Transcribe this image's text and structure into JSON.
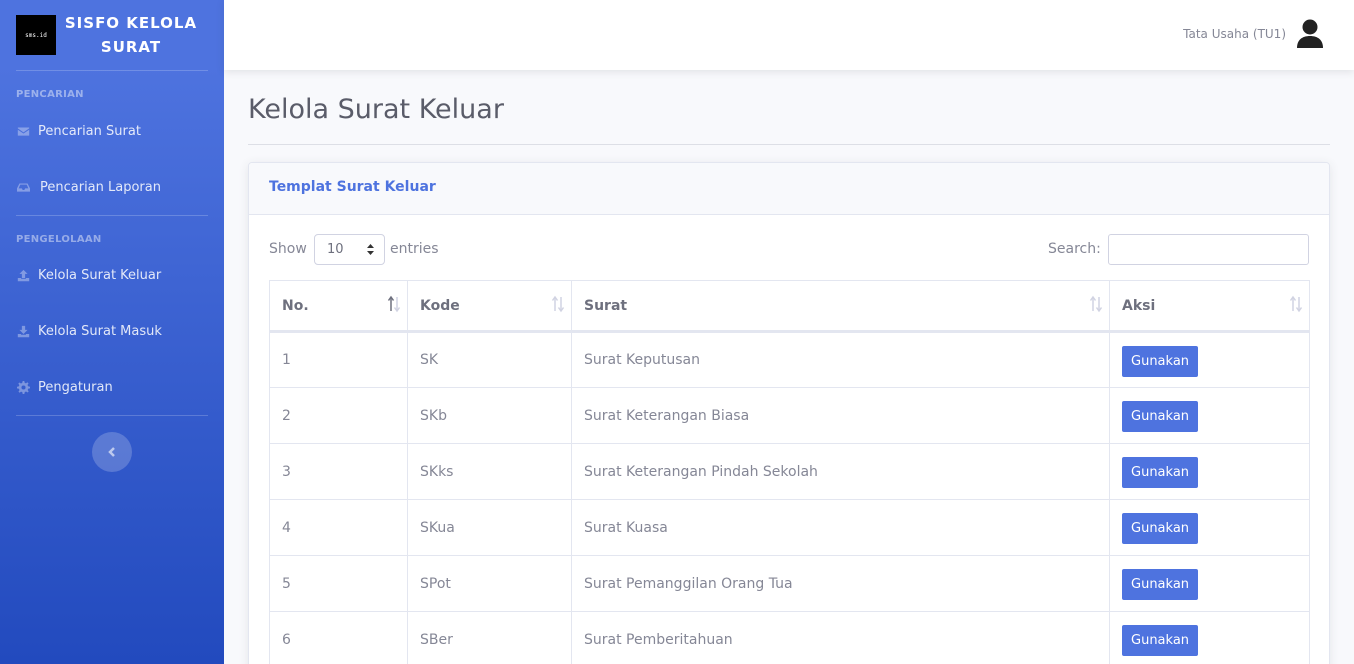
{
  "brand": {
    "title": "SISFO KELOLA SURAT",
    "logo_text": "sms.id"
  },
  "sidebar": {
    "heading_search": "PENCARIAN",
    "heading_manage": "PENGELOLAAN",
    "items": [
      {
        "label": "Pencarian Surat",
        "icon": "envelope-icon"
      },
      {
        "label": "Pencarian Laporan",
        "icon": "inbox-icon"
      },
      {
        "label": "Kelola Surat Keluar",
        "icon": "upload-icon"
      },
      {
        "label": "Kelola Surat Masuk",
        "icon": "download-icon"
      },
      {
        "label": "Pengaturan",
        "icon": "gear-icon"
      }
    ]
  },
  "topbar": {
    "user_name": "Tata Usaha (TU1)"
  },
  "page": {
    "title": "Kelola Surat Keluar"
  },
  "card": {
    "title": "Templat Surat Keluar"
  },
  "table_controls": {
    "show_label": "Show",
    "entries_label": "entries",
    "page_length": "10",
    "search_label": "Search:",
    "search_value": ""
  },
  "table": {
    "columns": [
      "No.",
      "Kode",
      "Surat",
      "Aksi"
    ],
    "action_label": "Gunakan",
    "rows": [
      {
        "no": "1",
        "kode": "SK",
        "surat": "Surat Keputusan"
      },
      {
        "no": "2",
        "kode": "SKb",
        "surat": "Surat Keterangan Biasa"
      },
      {
        "no": "3",
        "kode": "SKks",
        "surat": "Surat Keterangan Pindah Sekolah"
      },
      {
        "no": "4",
        "kode": "SKua",
        "surat": "Surat Kuasa"
      },
      {
        "no": "5",
        "kode": "SPot",
        "surat": "Surat Pemanggilan Orang Tua"
      },
      {
        "no": "6",
        "kode": "SBer",
        "surat": "Surat Pemberitahuan"
      }
    ]
  },
  "colors": {
    "primary": "#4e73df",
    "sidebar_dark": "#224abe",
    "text_muted": "#858796"
  }
}
